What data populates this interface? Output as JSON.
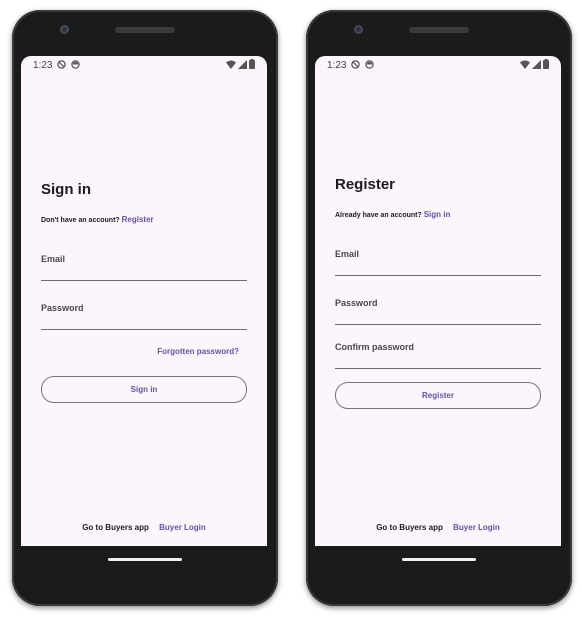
{
  "status": {
    "time": "1:23"
  },
  "signin": {
    "title": "Sign in",
    "prompt": "Don't have an account?",
    "prompt_link": "Register",
    "email_label": "Email",
    "password_label": "Password",
    "forgot_link": "Forgotten password?",
    "button": "Sign in",
    "footer_text": "Go to Buyers app",
    "footer_link": "Buyer Login"
  },
  "register": {
    "title": "Register",
    "prompt": "Already have an account?",
    "prompt_link": "Sign in",
    "email_label": "Email",
    "password_label": "Password",
    "confirm_label": "Confirm password",
    "button": "Register",
    "footer_text": "Go to Buyers app",
    "footer_link": "Buyer Login"
  },
  "colors": {
    "accent": "#6750a4",
    "screen_bg": "#fcf5fb",
    "frame": "#1b1b1b"
  },
  "icons": [
    "do-not-disturb-icon",
    "privacy-icon",
    "wifi-icon",
    "signal-icon",
    "battery-icon"
  ]
}
